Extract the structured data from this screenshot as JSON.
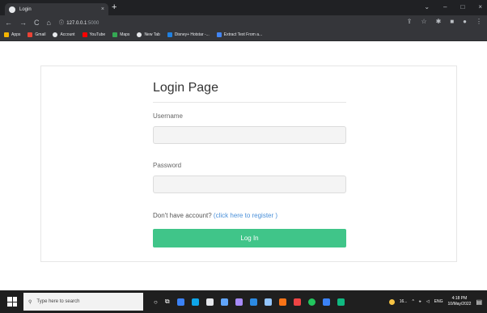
{
  "browser": {
    "tab_title": "Login",
    "tab_close": "×",
    "new_tab": "+",
    "back": "←",
    "forward": "→",
    "reload": "C",
    "home": "⌂",
    "info": "ⓘ",
    "url_host": "127.0.0.1",
    "url_port": ":5000",
    "minimize": "–",
    "maximize": "□",
    "close": "×"
  },
  "bookmarks": [
    {
      "label": "Apps",
      "color": "#f4b400"
    },
    {
      "label": "Gmail",
      "color": "#ea4335"
    },
    {
      "label": "Account",
      "color": "#e8eaed"
    },
    {
      "label": "YouTube",
      "color": "#ff0000"
    },
    {
      "label": "Maps",
      "color": "#34a853"
    },
    {
      "label": "New Tab",
      "color": "#e8eaed"
    },
    {
      "label": "Disney+ Hotstar -...",
      "color": "#1f80e0"
    },
    {
      "label": "Extract Text From a...",
      "color": "#4285f4"
    }
  ],
  "login": {
    "title": "Login Page",
    "username_label": "Username",
    "username_value": "",
    "password_label": "Password",
    "password_value": "",
    "register_prompt": "Don't have account?",
    "register_link": "(click here to register )",
    "submit_label": "Log In"
  },
  "taskbar": {
    "search_placeholder": "Type here to search",
    "weather": "16...",
    "language": "ENG",
    "time": "4:18 PM",
    "date": "10/May/2022"
  },
  "colors": {
    "login_button": "#40c589",
    "register_link": "#4a90d9",
    "browser_chrome": "#35363a"
  }
}
